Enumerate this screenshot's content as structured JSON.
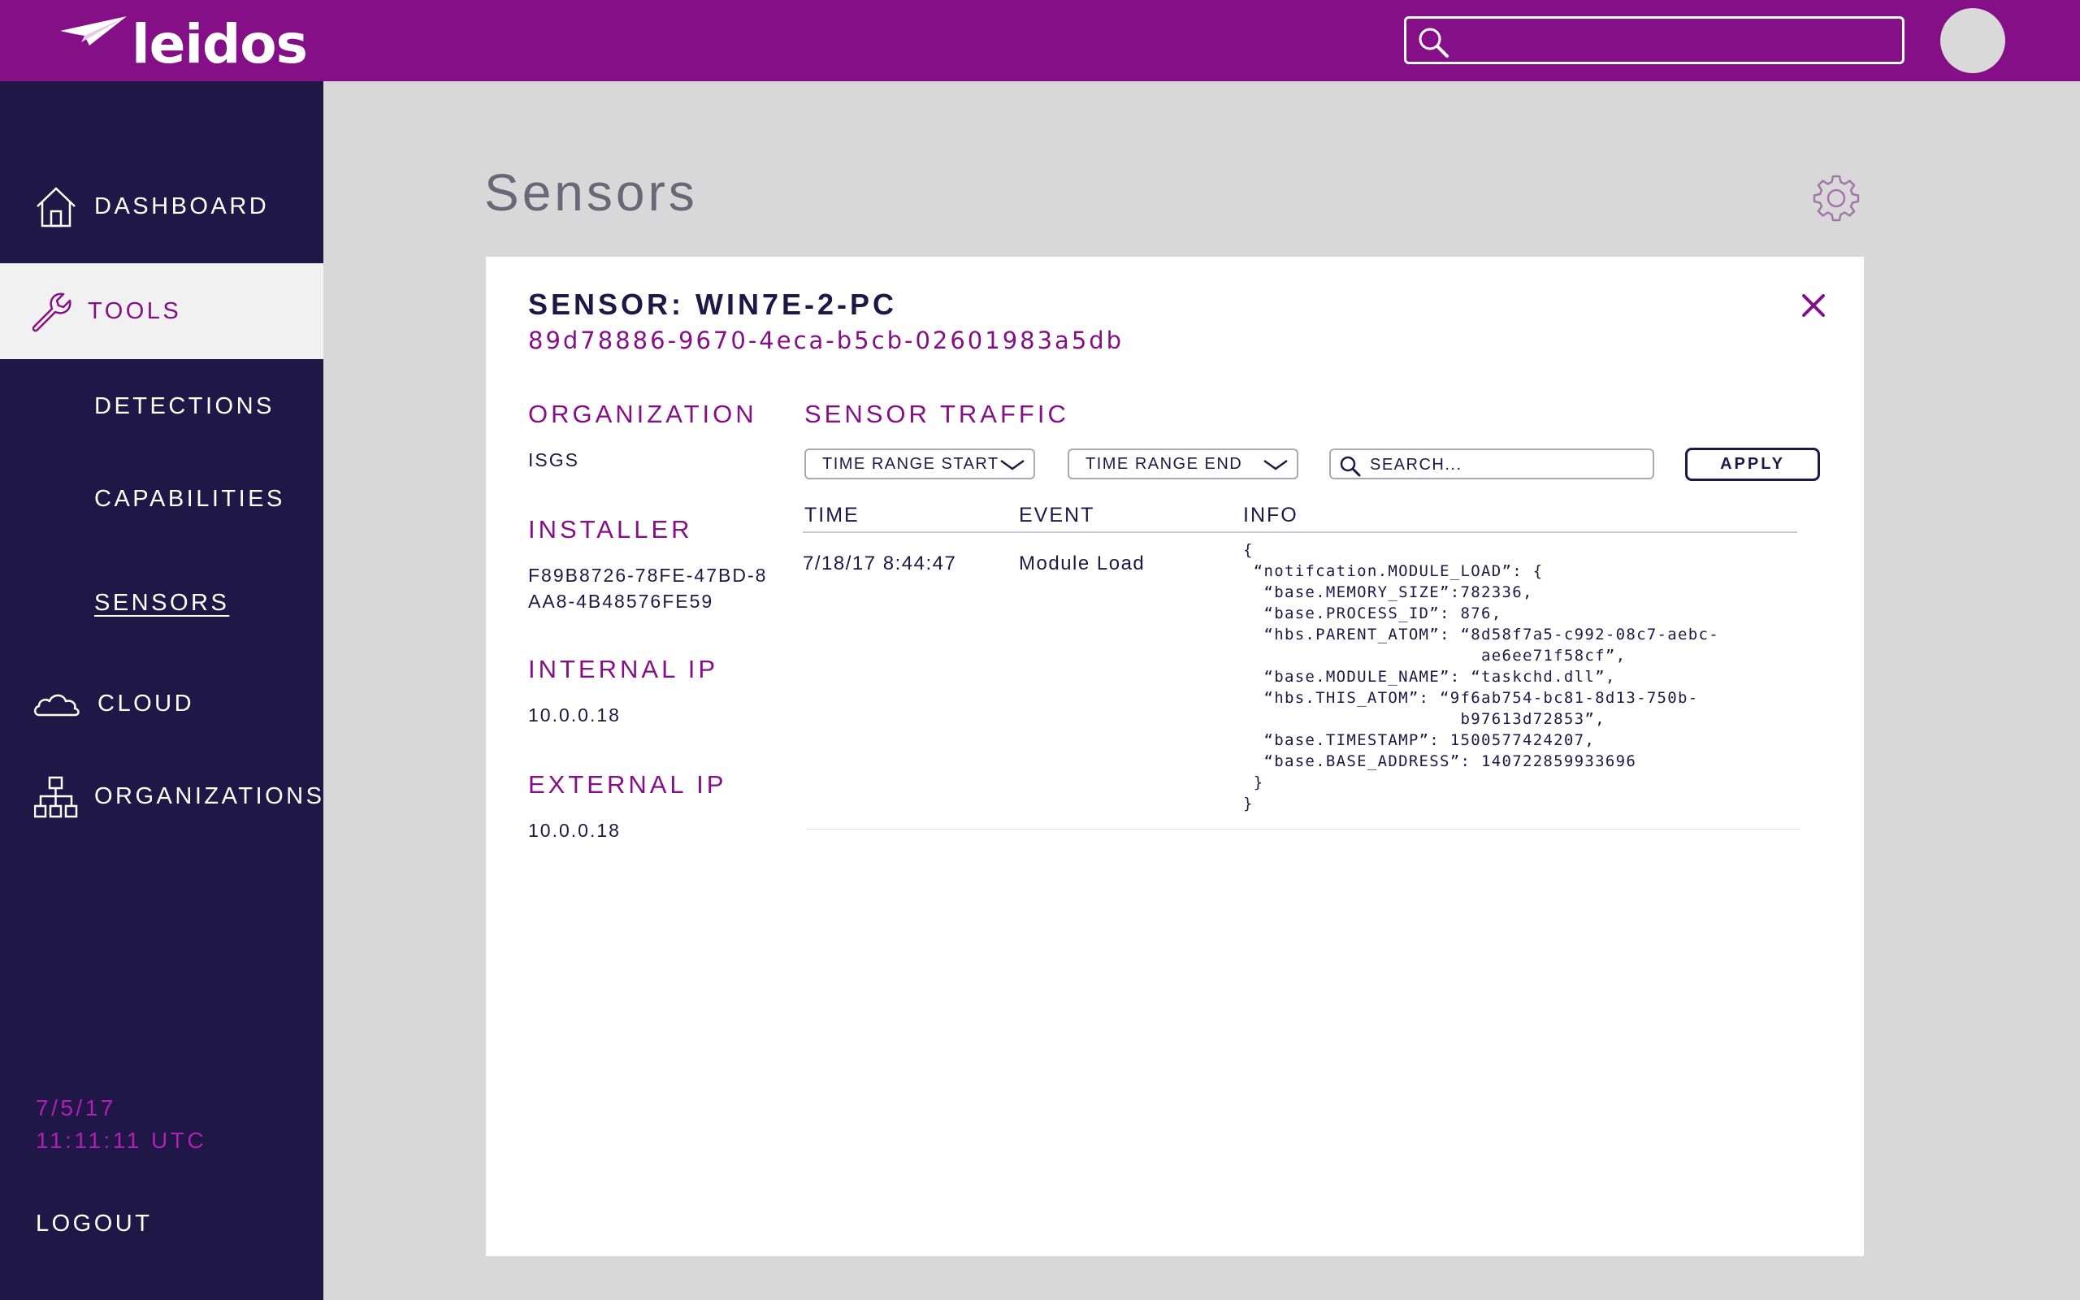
{
  "brand": {
    "name": "leidos"
  },
  "header": {
    "search": {
      "value": "",
      "placeholder": ""
    }
  },
  "sidebar": {
    "items": [
      {
        "label": "DASHBOARD",
        "icon": "home-icon"
      },
      {
        "label": "TOOLS",
        "icon": "wrench-icon"
      },
      {
        "label": "DETECTIONS"
      },
      {
        "label": "CAPABILITIES"
      },
      {
        "label": "SENSORS"
      },
      {
        "label": "CLOUD",
        "icon": "cloud-icon"
      },
      {
        "label": "ORGANIZATIONS",
        "icon": "org-chart-icon"
      }
    ],
    "date": "7/5/17",
    "time": "11:11:11 UTC",
    "logout": "LOGOUT"
  },
  "page": {
    "title": "Sensors",
    "settings_icon": "gear-icon"
  },
  "sensor": {
    "title": "SENSOR: WIN7E-2-PC",
    "id": "89d78886-9670-4eca-b5cb-02601983a5db",
    "fields": [
      {
        "label": "ORGANIZATION",
        "value": "ISGS"
      },
      {
        "label": "INSTALLER",
        "value_line1": "F89B8726-78FE-47BD-8",
        "value_line2": "AA8-4B48576FE59"
      },
      {
        "label": "INTERNAL IP",
        "value": "10.0.0.18"
      },
      {
        "label": "EXTERNAL IP",
        "value": "10.0.0.18"
      }
    ]
  },
  "traffic": {
    "title": "SENSOR TRAFFIC",
    "time_start": "TIME RANGE START",
    "time_end": "TIME RANGE END",
    "search_placeholder": "SEARCH...",
    "apply": "APPLY",
    "columns": [
      "TIME",
      "EVENT",
      "INFO"
    ],
    "rows": [
      {
        "time": "7/18/17 8:44:47",
        "event": "Module Load",
        "info": "{\n “notifcation.MODULE_LOAD”: {\n  “base.MEMORY_SIZE”:782336,\n  “base.PROCESS_ID”: 876,\n  “hbs.PARENT_ATOM”: “8d58f7a5-c992-08c7-aebc-\n                       ae6ee71f58cf”,\n  “base.MODULE_NAME”: “taskchd.dll”,\n  “hbs.THIS_ATOM”: “9f6ab754-bc81-8d13-750b-\n                     b97613d72853”,\n  “base.TIMESTAMP”: 1500577424207,\n  “base.BASE_ADDRESS”: 140722859933696\n }\n}"
      }
    ]
  },
  "colors": {
    "brand_purple": "#850f87",
    "sidebar_navy": "#1f1746",
    "accent_magenta": "#b21fb7"
  }
}
